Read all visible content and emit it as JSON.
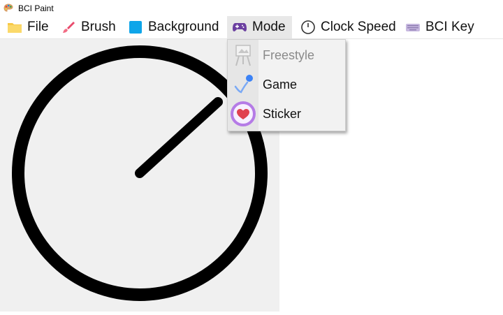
{
  "window": {
    "title": "BCI Paint"
  },
  "menu": {
    "items": [
      {
        "label": "File",
        "icon": "folder-icon"
      },
      {
        "label": "Brush",
        "icon": "brush-icon"
      },
      {
        "label": "Background",
        "icon": "color-square-icon"
      },
      {
        "label": "Mode",
        "icon": "gamepad-icon"
      },
      {
        "label": "Clock Speed",
        "icon": "clock-icon"
      },
      {
        "label": "BCI Key",
        "icon": "keyboard-icon"
      }
    ]
  },
  "mode_dropdown": {
    "items": [
      {
        "label": "Freestyle",
        "icon": "easel-icon",
        "enabled": false
      },
      {
        "label": "Game",
        "icon": "game-target-icon",
        "enabled": true
      },
      {
        "label": "Sticker",
        "icon": "heart-sticker-icon",
        "enabled": true
      }
    ]
  },
  "colors": {
    "folder": "#f7c948",
    "brush": "#e94b6c",
    "background_swatch": "#0ea5e9",
    "gamepad": "#6b3fa0",
    "sticker_ring": "#b57be6",
    "heart": "#e0404f",
    "canvas_bg": "#f0f0f0",
    "stroke": "#000000"
  }
}
